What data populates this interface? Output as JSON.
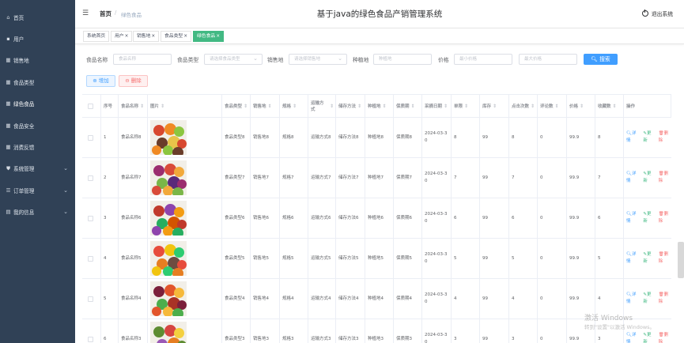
{
  "sidebar": {
    "items": [
      {
        "label": "首页",
        "icon": "home-icon",
        "glyph": "⌂",
        "expandable": false
      },
      {
        "label": "用户",
        "icon": "user-icon",
        "glyph": "▪",
        "expandable": false
      },
      {
        "label": "销售地",
        "icon": "grid-icon",
        "glyph": "▦",
        "expandable": false
      },
      {
        "label": "食品类型",
        "icon": "grid-icon",
        "glyph": "▦",
        "expandable": false
      },
      {
        "label": "绿色食品",
        "icon": "grid-icon",
        "glyph": "▦",
        "expandable": false
      },
      {
        "label": "食品安全",
        "icon": "grid-icon",
        "glyph": "▦",
        "expandable": false
      },
      {
        "label": "消费反馈",
        "icon": "grid-icon",
        "glyph": "▦",
        "expandable": false
      },
      {
        "label": "系统管理",
        "icon": "shield-icon",
        "glyph": "⛊",
        "expandable": true
      },
      {
        "label": "订单管理",
        "icon": "list-icon",
        "glyph": "☰",
        "expandable": true
      },
      {
        "label": "我的信息",
        "icon": "document-icon",
        "glyph": "▤",
        "expandable": true
      }
    ]
  },
  "header": {
    "crumb_home": "首页",
    "crumb_sep": "/",
    "crumb_current": "绿色食品",
    "title": "基于java的绿色食品产销管理系统",
    "logout": "退出系统"
  },
  "tags": [
    {
      "label": "系统首页",
      "closable": false
    },
    {
      "label": "用户",
      "closable": true
    },
    {
      "label": "销售地",
      "closable": true
    },
    {
      "label": "食品类型",
      "closable": true
    },
    {
      "label": "绿色食品",
      "closable": true,
      "active": true
    }
  ],
  "search": {
    "name_label": "食品名称",
    "name_placeholder": "食品名称",
    "type_label": "食品类型",
    "type_placeholder": "请选择食品类型",
    "place_label": "销售地",
    "place_placeholder": "请选择销售地",
    "plant_label": "种植地",
    "plant_placeholder": "种植地",
    "price_label": "价格",
    "min_placeholder": "最小价格",
    "max_placeholder": "最大价格",
    "button": "搜索"
  },
  "actions": {
    "add": "增加",
    "delete": "删除"
  },
  "table": {
    "columns": [
      "序号",
      "食品名称",
      "图片",
      "食品类型",
      "销售地",
      "规格",
      "运输方式",
      "储存方法",
      "种植地",
      "保质期",
      "采摘日期",
      "单限",
      "库存",
      "点击次数",
      "评论数",
      "价格",
      "收藏数",
      "操作"
    ],
    "rows": [
      {
        "no": "1",
        "name": "食品名称8",
        "type": "食品类型8",
        "place": "销售地8",
        "spec": "规格8",
        "transport": "运输方式8",
        "storage": "储存方法8",
        "plant": "种植地8",
        "shelf": "保质期8",
        "date": "2024-03-30",
        "limit": "8",
        "stock": "99",
        "clicks": "8",
        "comments": "0",
        "price": "99.9",
        "fav": "8"
      },
      {
        "no": "2",
        "name": "食品名称7",
        "type": "食品类型7",
        "place": "销售地7",
        "spec": "规格7",
        "transport": "运输方式7",
        "storage": "储存方法7",
        "plant": "种植地7",
        "shelf": "保质期7",
        "date": "2024-03-30",
        "limit": "7",
        "stock": "99",
        "clicks": "7",
        "comments": "0",
        "price": "99.9",
        "fav": "7"
      },
      {
        "no": "3",
        "name": "食品名称6",
        "type": "食品类型6",
        "place": "销售地6",
        "spec": "规格6",
        "transport": "运输方式6",
        "storage": "储存方法6",
        "plant": "种植地6",
        "shelf": "保质期6",
        "date": "2024-03-30",
        "limit": "6",
        "stock": "99",
        "clicks": "6",
        "comments": "0",
        "price": "99.9",
        "fav": "6"
      },
      {
        "no": "4",
        "name": "食品名称5",
        "type": "食品类型5",
        "place": "销售地5",
        "spec": "规格5",
        "transport": "运输方式5",
        "storage": "储存方法5",
        "plant": "种植地5",
        "shelf": "保质期5",
        "date": "2024-03-30",
        "limit": "5",
        "stock": "99",
        "clicks": "5",
        "comments": "0",
        "price": "99.9",
        "fav": "5"
      },
      {
        "no": "5",
        "name": "食品名称4",
        "type": "食品类型4",
        "place": "销售地4",
        "spec": "规格4",
        "transport": "运输方式4",
        "storage": "储存方法4",
        "plant": "种植地4",
        "shelf": "保质期4",
        "date": "2024-03-30",
        "limit": "4",
        "stock": "99",
        "clicks": "4",
        "comments": "0",
        "price": "99.9",
        "fav": "4"
      },
      {
        "no": "6",
        "name": "食品名称3",
        "type": "食品类型3",
        "place": "销售地3",
        "spec": "规格3",
        "transport": "运输方式3",
        "storage": "储存方法3",
        "plant": "种植地3",
        "shelf": "保质期3",
        "date": "2024-03-30",
        "limit": "3",
        "stock": "99",
        "clicks": "3",
        "comments": "0",
        "price": "99.9",
        "fav": "3"
      }
    ],
    "ops": {
      "detail": "详情",
      "edit": "更新",
      "delete": "删除"
    }
  },
  "watermark": {
    "line1": "激活 Windows",
    "line2": "转到\"设置\"以激活 Windows。"
  },
  "colors": {
    "sidebar": "#304156",
    "primary": "#409eff",
    "success": "#42b983",
    "danger": "#f56c6c"
  }
}
